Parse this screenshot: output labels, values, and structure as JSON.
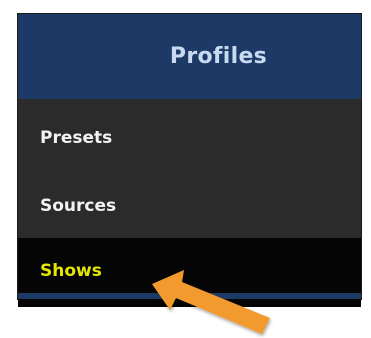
{
  "menu": {
    "title": "Profiles",
    "items": [
      {
        "label": "Presets"
      },
      {
        "label": "Sources"
      },
      {
        "label": "Shows"
      }
    ]
  },
  "colors": {
    "header_bg": "#1d3a66",
    "header_text": "#c8daf0",
    "item_bg": "#2b2b2b",
    "item_text": "#f2f2f2",
    "selected_bg": "#050505",
    "selected_text": "#e6e600",
    "arrow": "#f29a2e"
  },
  "annotation": {
    "icon": "orange-arrow-icon"
  }
}
